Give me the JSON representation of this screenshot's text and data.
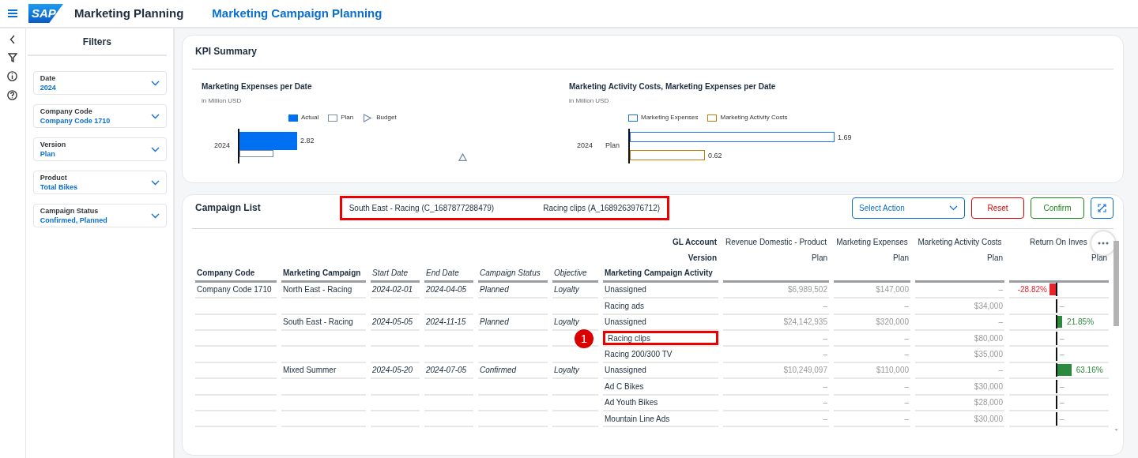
{
  "app": {
    "logo": "SAP",
    "title": "Marketing Planning",
    "page_title": "Marketing Campaign Planning"
  },
  "filters": {
    "title": "Filters",
    "items": [
      {
        "label": "Date",
        "value": "2024"
      },
      {
        "label": "Company Code",
        "value": "Company Code 1710"
      },
      {
        "label": "Version",
        "value": "Plan"
      },
      {
        "label": "Product",
        "value": "Total Bikes"
      },
      {
        "label": "Campaign Status",
        "value": "Confirmed, Planned"
      }
    ]
  },
  "kpi_summary": {
    "title": "KPI Summary",
    "charts": [
      {
        "title": "Marketing Expenses per Date",
        "subtitle": "in Million USD",
        "category": "2024",
        "legend": [
          {
            "name": "Actual",
            "color": "#0070f2",
            "kind": "filled",
            "value_label": "2.82"
          },
          {
            "name": "Plan",
            "color": "#758ca4",
            "kind": "outline"
          },
          {
            "name": "Budget",
            "color": "#758ca4",
            "kind": "marker"
          }
        ]
      },
      {
        "title": "Marketing Activity Costs, Marketing Expenses per Date",
        "subtitle": "in Million USD",
        "category": "2024",
        "category_label": "Plan",
        "legend": [
          {
            "name": "Marketing Expenses",
            "color": "#1d6ff2",
            "kind": "outline",
            "value_label": "1.69"
          },
          {
            "name": "Marketing Activity Costs",
            "color": "#c87b00",
            "kind": "outline",
            "value_label": "0.62"
          }
        ]
      }
    ]
  },
  "campaign_list": {
    "title": "Campaign List",
    "selection": [
      "South East - Racing (C_1687877288479)",
      "Racing clips (A_1689263976712)"
    ],
    "actions": {
      "select_placeholder": "Select Action",
      "buttons": [
        {
          "label": "Reset",
          "kind": "reset"
        },
        {
          "label": "Confirm",
          "kind": "confirm"
        }
      ]
    },
    "table": {
      "gl_label": "GL Account",
      "version_label": "Version",
      "columns": [
        {
          "label": "Company Code",
          "kind": "dimension"
        },
        {
          "label": "Marketing Campaign",
          "kind": "dimension"
        },
        {
          "label": "Start Date",
          "kind": "attribute"
        },
        {
          "label": "End Date",
          "kind": "attribute"
        },
        {
          "label": "Campaign Status",
          "kind": "attribute"
        },
        {
          "label": "Objective",
          "kind": "attribute"
        },
        {
          "label": "Marketing Campaign Activity",
          "kind": "dimension"
        },
        {
          "gl_account": "Revenue Domestic - Product",
          "version": "Plan",
          "kind": "measure"
        },
        {
          "gl_account": "Marketing Expenses",
          "version": "Plan",
          "kind": "measure"
        },
        {
          "gl_account": "Marketing Activity Costs",
          "version": "Plan",
          "kind": "measure"
        },
        {
          "gl_account": "Return On Inves",
          "version": "Plan",
          "kind": "ratio"
        }
      ],
      "rows": [
        {
          "cells": [
            "Company Code 1710",
            "North East - Racing",
            "2024-02-01",
            "2024-04-05",
            "Planned",
            "Loyalty",
            "Unassigned",
            "$6,989,502",
            "$147,000",
            "–"
          ],
          "roi": {
            "text": "-28.82%",
            "kind": "negative"
          },
          "highlighted": false
        },
        {
          "cells": [
            "Racing ads",
            "–",
            "–",
            "$34,000"
          ],
          "roi": {
            "text": "–",
            "kind": "empty"
          },
          "highlighted": false
        },
        {
          "cells": [
            "South East - Racing",
            "2024-05-05",
            "2024-11-15",
            "Planned",
            "Loyalty",
            "Unassigned",
            "$24,142,935",
            "$320,000",
            "–"
          ],
          "roi": {
            "text": "21.85%",
            "kind": "positive"
          },
          "highlighted": false
        },
        {
          "cells": [
            "Racing clips",
            "–",
            "–",
            "$80,000"
          ],
          "roi": {
            "text": "–",
            "kind": "empty"
          },
          "highlighted": true,
          "callout": "1"
        },
        {
          "cells": [
            "Racing 200/300 TV",
            "–",
            "–",
            "$35,000"
          ],
          "roi": {
            "text": "–",
            "kind": "empty"
          },
          "highlighted": false
        },
        {
          "cells": [
            "Mixed Summer",
            "2024-05-20",
            "2024-07-05",
            "Confirmed",
            "Loyalty",
            "Unassigned",
            "$10,249,097",
            "$110,000",
            "–"
          ],
          "roi": {
            "text": "63.16%",
            "kind": "positive"
          },
          "highlighted": false
        },
        {
          "cells": [
            "Ad C Bikes",
            "–",
            "–",
            "$30,000"
          ],
          "roi": {
            "text": "–",
            "kind": "empty"
          },
          "highlighted": false
        },
        {
          "cells": [
            "Ad Youth Bikes",
            "–",
            "–",
            "$28,000"
          ],
          "roi": {
            "text": "–",
            "kind": "empty"
          },
          "highlighted": false
        },
        {
          "cells": [
            "Mountain Line Ads",
            "–",
            "–",
            "$30,000"
          ],
          "roi": {
            "text": "–",
            "kind": "empty"
          },
          "highlighted": false
        }
      ]
    }
  }
}
